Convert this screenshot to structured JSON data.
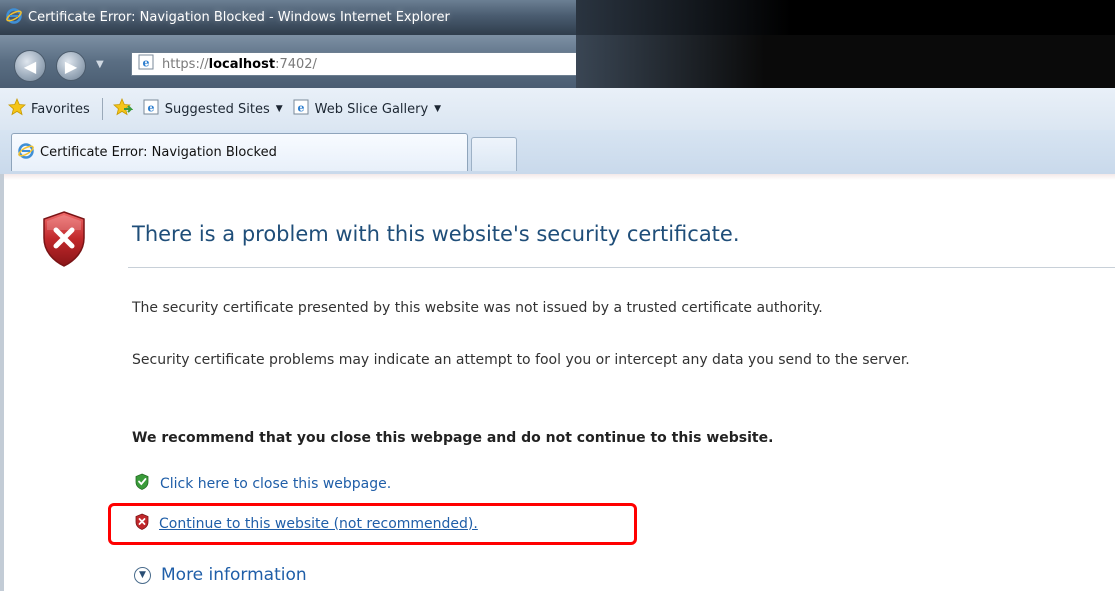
{
  "window": {
    "title": "Certificate Error: Navigation Blocked - Windows Internet Explorer"
  },
  "address_bar": {
    "scheme": "https://",
    "host": "localhost",
    "port": ":7402/"
  },
  "favorites_bar": {
    "favorites_label": "Favorites",
    "suggested_sites_label": "Suggested Sites",
    "web_slice_gallery_label": "Web Slice Gallery"
  },
  "tab": {
    "label": "Certificate Error: Navigation Blocked"
  },
  "content": {
    "headline": "There is a problem with this website's security certificate.",
    "paragraph1": "The security certificate presented by this website was not issued by a trusted certificate authority.",
    "paragraph2": "Security certificate problems may indicate an attempt to fool you or intercept any data you send to the server.",
    "recommendation": "We recommend that you close this webpage and do not continue to this website.",
    "close_link": "Click here to close this webpage.",
    "continue_link": "Continue to this website (not recommended).",
    "more_info": "More information"
  },
  "colors": {
    "link": "#1f5ea8",
    "headline": "#1f4e79",
    "highlight": "#ff0000",
    "error_shield": "#c0282b",
    "ok_shield": "#3a9b3a"
  }
}
